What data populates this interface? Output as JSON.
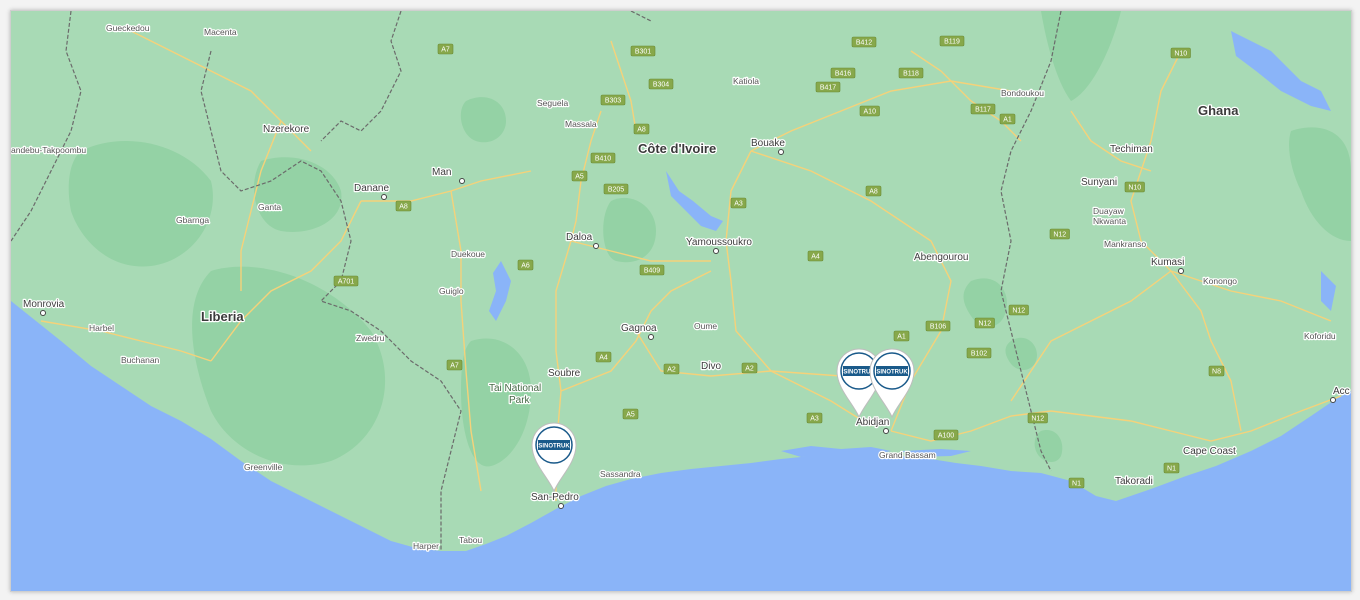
{
  "countries": [
    {
      "id": "cote-divoire",
      "label": "Côte d'Ivoire"
    },
    {
      "id": "liberia",
      "label": "Liberia"
    },
    {
      "id": "ghana",
      "label": "Ghana"
    }
  ],
  "cities": [
    {
      "id": "gueckedou",
      "label": "Gueckedou"
    },
    {
      "id": "macenta",
      "label": "Macenta"
    },
    {
      "id": "nzerekore",
      "label": "Nzerekore"
    },
    {
      "id": "andebu",
      "label": "andebu-Takpoombu"
    },
    {
      "id": "ganta",
      "label": "Ganta"
    },
    {
      "id": "gbarnga",
      "label": "Gbarnga"
    },
    {
      "id": "monrovia",
      "label": "Monrovia"
    },
    {
      "id": "harbel",
      "label": "Harbel"
    },
    {
      "id": "buchanan",
      "label": "Buchanan"
    },
    {
      "id": "zwedru",
      "label": "Zwedru"
    },
    {
      "id": "greenville",
      "label": "Greenville"
    },
    {
      "id": "harper",
      "label": "Harper"
    },
    {
      "id": "tabou",
      "label": "Tabou"
    },
    {
      "id": "danane",
      "label": "Danane"
    },
    {
      "id": "man",
      "label": "Man"
    },
    {
      "id": "duekoue",
      "label": "Duekoue"
    },
    {
      "id": "guiglo",
      "label": "Guiglo"
    },
    {
      "id": "seguela",
      "label": "Seguela"
    },
    {
      "id": "massala",
      "label": "Massala"
    },
    {
      "id": "katiola",
      "label": "Katiola"
    },
    {
      "id": "bouake",
      "label": "Bouake"
    },
    {
      "id": "daloa",
      "label": "Daloa"
    },
    {
      "id": "yamoussoukro",
      "label": "Yamoussoukro"
    },
    {
      "id": "oume",
      "label": "Oume"
    },
    {
      "id": "gagnoa",
      "label": "Gagnoa"
    },
    {
      "id": "soubre",
      "label": "Soubre"
    },
    {
      "id": "divo",
      "label": "Divo"
    },
    {
      "id": "sassandra",
      "label": "Sassandra"
    },
    {
      "id": "san-pedro",
      "label": "San-Pedro"
    },
    {
      "id": "abidjan",
      "label": "Abidjan"
    },
    {
      "id": "grand-bassam",
      "label": "Grand Bassam"
    },
    {
      "id": "abengourou",
      "label": "Abengourou"
    },
    {
      "id": "bondoukou",
      "label": "Bondoukou"
    },
    {
      "id": "techiman",
      "label": "Techiman"
    },
    {
      "id": "sunyani",
      "label": "Sunyani"
    },
    {
      "id": "duayaw",
      "label": "Duayaw\nNkwanta"
    },
    {
      "id": "mankranso",
      "label": "Mankranso"
    },
    {
      "id": "kumasi",
      "label": "Kumasi"
    },
    {
      "id": "konongo",
      "label": "Konongo"
    },
    {
      "id": "koforidua",
      "label": "Koforidu"
    },
    {
      "id": "cape-coast",
      "label": "Cape Coast"
    },
    {
      "id": "takoradi",
      "label": "Takoradi"
    },
    {
      "id": "accra",
      "label": "Acc"
    }
  ],
  "parks": [
    {
      "id": "tai",
      "label": "Tai National\nPark"
    }
  ],
  "roads": [
    "A7",
    "B301",
    "B412",
    "B119",
    "N10",
    "B416",
    "B118",
    "B304",
    "B417",
    "B303",
    "A10",
    "B117",
    "A8",
    "A1",
    "B410",
    "A5",
    "B205",
    "A3",
    "A8",
    "A8",
    "N10",
    "A6",
    "A4",
    "N12",
    "B409",
    "A701",
    "A7",
    "A1",
    "B106",
    "N12",
    "N12",
    "A4",
    "A2",
    "A2",
    "B102",
    "A3",
    "A5",
    "N12",
    "A100",
    "N8",
    "N1",
    "N1"
  ],
  "markers": [
    {
      "id": "san-pedro",
      "brand": "SINOTRUK"
    },
    {
      "id": "abidjan-1",
      "brand": "SINOTRUK"
    },
    {
      "id": "abidjan-2",
      "brand": "SINOTRUK"
    }
  ],
  "colors": {
    "ocean": "#8ab4f8",
    "land": "#a8dab5",
    "forest": "#94d2a5",
    "road": "#f5d27a",
    "border": "#6b6b6b",
    "marker": "#ffffff",
    "brand": "#1a5a8a"
  }
}
